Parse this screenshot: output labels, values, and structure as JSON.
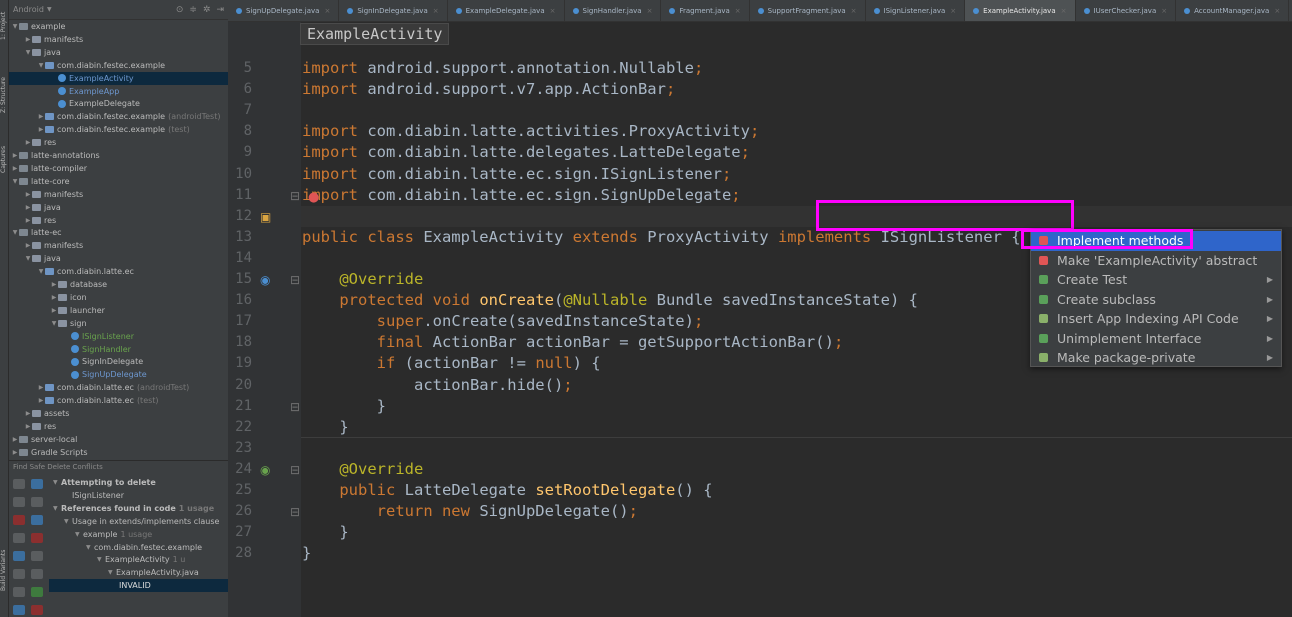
{
  "tool_strip": {
    "labels": [
      "1: Project",
      "Z: Structure",
      "Captures",
      "Build Variants"
    ]
  },
  "project_panel": {
    "view_mode": "Android",
    "tree": [
      {
        "label": "example",
        "depth": 0,
        "kind": "mod",
        "expanded": true
      },
      {
        "label": "manifests",
        "depth": 1,
        "kind": "folder",
        "expanded": false
      },
      {
        "label": "java",
        "depth": 1,
        "kind": "folder",
        "expanded": true
      },
      {
        "label": "com.diabin.festec.example",
        "depth": 2,
        "kind": "src",
        "expanded": true
      },
      {
        "label": "ExampleActivity",
        "depth": 3,
        "kind": "cls",
        "color": "blue",
        "selected": true
      },
      {
        "label": "ExampleApp",
        "depth": 3,
        "kind": "cls",
        "color": "blue"
      },
      {
        "label": "ExampleDelegate",
        "depth": 3,
        "kind": "cls"
      },
      {
        "label": "com.diabin.festec.example",
        "depth": 2,
        "kind": "src",
        "expanded": false,
        "suffix": "(androidTest)"
      },
      {
        "label": "com.diabin.festec.example",
        "depth": 2,
        "kind": "src",
        "expanded": false,
        "suffix": "(test)"
      },
      {
        "label": "res",
        "depth": 1,
        "kind": "folder",
        "expanded": false
      },
      {
        "label": "latte-annotations",
        "depth": 0,
        "kind": "mod",
        "expanded": false
      },
      {
        "label": "latte-compiler",
        "depth": 0,
        "kind": "mod",
        "expanded": false
      },
      {
        "label": "latte-core",
        "depth": 0,
        "kind": "mod",
        "expanded": true
      },
      {
        "label": "manifests",
        "depth": 1,
        "kind": "folder",
        "expanded": false
      },
      {
        "label": "java",
        "depth": 1,
        "kind": "folder",
        "expanded": false
      },
      {
        "label": "res",
        "depth": 1,
        "kind": "folder",
        "expanded": false
      },
      {
        "label": "latte-ec",
        "depth": 0,
        "kind": "mod",
        "expanded": true
      },
      {
        "label": "manifests",
        "depth": 1,
        "kind": "folder",
        "expanded": false
      },
      {
        "label": "java",
        "depth": 1,
        "kind": "folder",
        "expanded": true
      },
      {
        "label": "com.diabin.latte.ec",
        "depth": 2,
        "kind": "src",
        "expanded": true
      },
      {
        "label": "database",
        "depth": 3,
        "kind": "folder",
        "expanded": false
      },
      {
        "label": "icon",
        "depth": 3,
        "kind": "folder",
        "expanded": false
      },
      {
        "label": "launcher",
        "depth": 3,
        "kind": "folder",
        "expanded": false
      },
      {
        "label": "sign",
        "depth": 3,
        "kind": "folder",
        "expanded": true
      },
      {
        "label": "ISignListener",
        "depth": 4,
        "kind": "cls",
        "color": "green"
      },
      {
        "label": "SignHandler",
        "depth": 4,
        "kind": "cls",
        "color": "green"
      },
      {
        "label": "SignInDelegate",
        "depth": 4,
        "kind": "cls"
      },
      {
        "label": "SignUpDelegate",
        "depth": 4,
        "kind": "cls",
        "color": "blue"
      },
      {
        "label": "com.diabin.latte.ec",
        "depth": 2,
        "kind": "src",
        "expanded": false,
        "suffix": "(androidTest)"
      },
      {
        "label": "com.diabin.latte.ec",
        "depth": 2,
        "kind": "src",
        "expanded": false,
        "suffix": "(test)"
      },
      {
        "label": "assets",
        "depth": 1,
        "kind": "folder",
        "expanded": false
      },
      {
        "label": "res",
        "depth": 1,
        "kind": "folder",
        "expanded": false
      },
      {
        "label": "server-local",
        "depth": 0,
        "kind": "mod",
        "expanded": false
      },
      {
        "label": "Gradle Scripts",
        "depth": 0,
        "kind": "mod",
        "expanded": false
      }
    ]
  },
  "find_panel": {
    "title": "Find Safe Delete Conflicts",
    "tree": [
      {
        "label": "Attempting to delete",
        "depth": 0,
        "bold": true
      },
      {
        "label": "ISignListener",
        "depth": 1
      },
      {
        "label": "References found in code",
        "depth": 0,
        "bold": true,
        "suffix": "1 usage"
      },
      {
        "label": "Usage in extends/implements clause",
        "depth": 1
      },
      {
        "label": "example",
        "depth": 2,
        "suffix": "1 usage"
      },
      {
        "label": "com.diabin.festec.example",
        "depth": 3
      },
      {
        "label": "ExampleActivity",
        "depth": 4,
        "suffix": "1 u"
      },
      {
        "label": "ExampleActivity.java",
        "depth": 5
      },
      {
        "label": "INVALID",
        "depth": 6,
        "invalid": true
      }
    ]
  },
  "tabs": [
    {
      "label": "SignUpDelegate.java"
    },
    {
      "label": "SignInDelegate.java"
    },
    {
      "label": "ExampleDelegate.java"
    },
    {
      "label": "SignHandler.java"
    },
    {
      "label": "Fragment.java"
    },
    {
      "label": "SupportFragment.java"
    },
    {
      "label": "ISignListener.java"
    },
    {
      "label": "ExampleActivity.java",
      "active": true
    },
    {
      "label": "IUserChecker.java"
    },
    {
      "label": "AccountManager.java"
    }
  ],
  "editor": {
    "breadcrumb": "ExampleActivity",
    "line_numbers": [
      "5",
      "6",
      "7",
      "8",
      "9",
      "10",
      "11",
      "12",
      "13",
      "14",
      "15",
      "16",
      "17",
      "18",
      "19",
      "20",
      "21",
      "22",
      "23",
      "24",
      "25",
      "26",
      "27",
      "28"
    ],
    "lines": [
      [
        {
          "t": "import",
          "c": "kw"
        },
        {
          "t": " android.support.annotation.Nullable",
          "c": ""
        },
        {
          "t": ";",
          "c": "kw"
        }
      ],
      [
        {
          "t": "import",
          "c": "kw"
        },
        {
          "t": " android.support.v7.app.ActionBar",
          "c": ""
        },
        {
          "t": ";",
          "c": "kw"
        }
      ],
      [],
      [
        {
          "t": "import",
          "c": "kw"
        },
        {
          "t": " com.diabin.latte.activities.ProxyActivity",
          "c": ""
        },
        {
          "t": ";",
          "c": "kw"
        }
      ],
      [
        {
          "t": "import",
          "c": "kw"
        },
        {
          "t": " com.diabin.latte.delegates.LatteDelegate",
          "c": ""
        },
        {
          "t": ";",
          "c": "kw"
        }
      ],
      [
        {
          "t": "import",
          "c": "kw"
        },
        {
          "t": " com.diabin.latte.ec.sign.ISignListener",
          "c": ""
        },
        {
          "t": ";",
          "c": "kw"
        }
      ],
      [
        {
          "t": "import",
          "c": "kw"
        },
        {
          "t": " com.diabin.latte.ec.sign.SignUpDelegate",
          "c": ""
        },
        {
          "t": ";",
          "c": "kw"
        }
      ],
      [],
      [
        {
          "t": "public class",
          "c": "kw"
        },
        {
          "t": " ExampleActivity ",
          "c": ""
        },
        {
          "t": "extends",
          "c": "kw"
        },
        {
          "t": " ProxyActivity ",
          "c": ""
        },
        {
          "t": "implements",
          "c": "kw"
        },
        {
          "t": " ISignListener {",
          "c": ""
        }
      ],
      [],
      [
        {
          "t": "    @Override",
          "c": "an"
        }
      ],
      [
        {
          "t": "    protected void",
          "c": "kw"
        },
        {
          "t": " ",
          "c": ""
        },
        {
          "t": "onCreate",
          "c": "fn"
        },
        {
          "t": "(",
          "c": ""
        },
        {
          "t": "@Nullable",
          "c": "an"
        },
        {
          "t": " Bundle savedInstanceState) {",
          "c": ""
        }
      ],
      [
        {
          "t": "        super",
          "c": "kw"
        },
        {
          "t": ".onCreate(savedInstanceState)",
          "c": ""
        },
        {
          "t": ";",
          "c": "kw"
        }
      ],
      [
        {
          "t": "        final",
          "c": "kw"
        },
        {
          "t": " ActionBar actionBar = getSupportActionBar()",
          "c": ""
        },
        {
          "t": ";",
          "c": "kw"
        }
      ],
      [
        {
          "t": "        if",
          "c": "kw"
        },
        {
          "t": " (actionBar != ",
          "c": ""
        },
        {
          "t": "null",
          "c": "kw"
        },
        {
          "t": ") {",
          "c": ""
        }
      ],
      [
        {
          "t": "            actionBar.hide()",
          "c": ""
        },
        {
          "t": ";",
          "c": "kw"
        }
      ],
      [
        {
          "t": "        }",
          "c": ""
        }
      ],
      [
        {
          "t": "    }",
          "c": ""
        }
      ],
      [],
      [
        {
          "t": "    @Override",
          "c": "an"
        }
      ],
      [
        {
          "t": "    public",
          "c": "kw"
        },
        {
          "t": " LatteDelegate ",
          "c": ""
        },
        {
          "t": "setRootDelegate",
          "c": "fn"
        },
        {
          "t": "() {",
          "c": ""
        }
      ],
      [
        {
          "t": "        return new",
          "c": "kw"
        },
        {
          "t": " SignUpDelegate()",
          "c": ""
        },
        {
          "t": ";",
          "c": "kw"
        }
      ],
      [
        {
          "t": "    }",
          "c": ""
        }
      ],
      [
        {
          "t": "}",
          "c": ""
        }
      ]
    ]
  },
  "intention_popup": {
    "items": [
      {
        "label": "Implement methods",
        "icon": "error-bulb",
        "selected": true,
        "submenu": false
      },
      {
        "label": "Make 'ExampleActivity' abstract",
        "icon": "error-bulb",
        "submenu": false
      },
      {
        "label": "Create Test",
        "icon": "intention",
        "submenu": true
      },
      {
        "label": "Create subclass",
        "icon": "intention",
        "submenu": true
      },
      {
        "label": "Insert App Indexing API Code",
        "icon": "pencil",
        "submenu": true
      },
      {
        "label": "Unimplement Interface",
        "icon": "intention",
        "submenu": true
      },
      {
        "label": "Make package-private",
        "icon": "pencil",
        "submenu": true
      }
    ]
  },
  "colors": {
    "selection_highlight": "#ff00ff",
    "menu_selected": "#2f65ca"
  }
}
